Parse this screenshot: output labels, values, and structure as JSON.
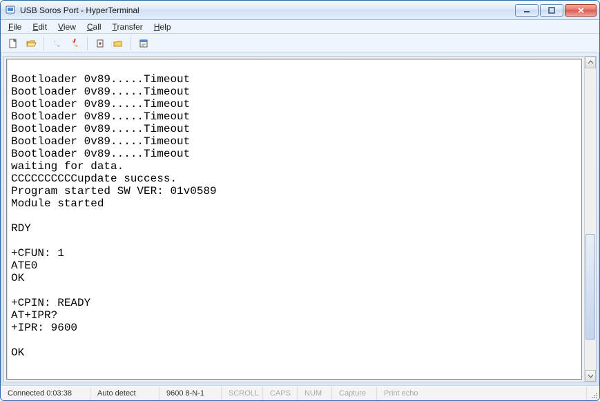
{
  "window": {
    "title": "USB Soros Port - HyperTerminal"
  },
  "menus": {
    "file": "File",
    "edit": "Edit",
    "view": "View",
    "call": "Call",
    "transfer": "Transfer",
    "help": "Help"
  },
  "terminal": {
    "lines": [
      "",
      "Bootloader 0v89.....Timeout",
      "Bootloader 0v89.....Timeout",
      "Bootloader 0v89.....Timeout",
      "Bootloader 0v89.....Timeout",
      "Bootloader 0v89.....Timeout",
      "Bootloader 0v89.....Timeout",
      "Bootloader 0v89.....Timeout",
      "waiting for data.",
      "CCCCCCCCCCupdate success.",
      "Program started SW VER: 01v0589",
      "Module started",
      "",
      "RDY",
      "",
      "+CFUN: 1",
      "ATE0",
      "OK",
      "",
      "+CPIN: READY",
      "AT+IPR?",
      "+IPR: 9600",
      "",
      "OK",
      ""
    ]
  },
  "status": {
    "connected": "Connected 0:03:38",
    "detect": "Auto detect",
    "serial": "9600 8-N-1",
    "scroll": "SCROLL",
    "caps": "CAPS",
    "num": "NUM",
    "capture": "Capture",
    "printecho": "Print echo"
  }
}
